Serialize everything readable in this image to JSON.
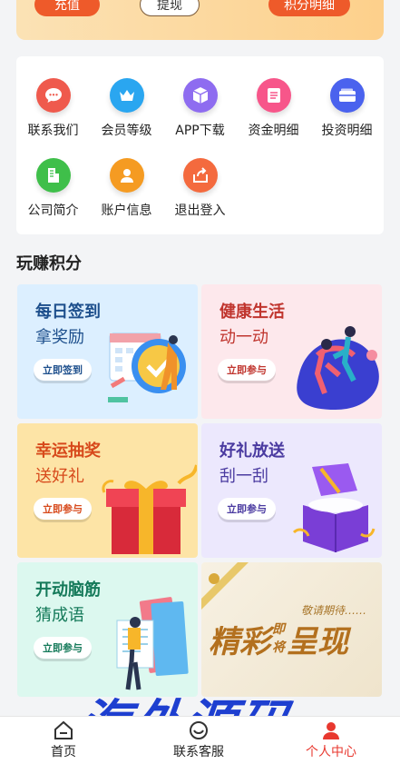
{
  "top_banner": {
    "recharge": "充值",
    "withdraw": "提现",
    "points_detail": "积分明细"
  },
  "grid": {
    "items": [
      {
        "label": "联系我们",
        "icon": "chat-icon",
        "color": "#ef5a4d"
      },
      {
        "label": "会员等级",
        "icon": "crown-icon",
        "color": "#2aa6f0"
      },
      {
        "label": "APP下载",
        "icon": "cube-icon",
        "color": "#8e6cf0"
      },
      {
        "label": "资金明细",
        "icon": "document-icon",
        "color": "#f7568a"
      },
      {
        "label": "投资明细",
        "icon": "wallet-icon",
        "color": "#4a62ee"
      },
      {
        "label": "公司简介",
        "icon": "building-icon",
        "color": "#3fbf4a"
      },
      {
        "label": "账户信息",
        "icon": "user-icon",
        "color": "#f59b22"
      },
      {
        "label": "退出登入",
        "icon": "logout-icon",
        "color": "#f46a3e"
      }
    ]
  },
  "section": {
    "title": "玩赚积分"
  },
  "cards": {
    "signin": {
      "title": "每日签到",
      "subtitle": "拿奖励",
      "button": "立即签到",
      "title_color": "#1d4f8c",
      "bg": "#dcefff"
    },
    "health": {
      "title": "健康生活",
      "subtitle": "动一动",
      "button": "立即参与",
      "title_color": "#c0352e",
      "bg": "#fde8ec"
    },
    "lottery": {
      "title": "幸运抽奖",
      "subtitle": "送好礼",
      "button": "立即参与",
      "title_color": "#d7491b",
      "bg": "#fde4a6"
    },
    "gift": {
      "title": "好礼放送",
      "subtitle": "刮一刮",
      "button": "立即参与",
      "title_color": "#4a3aa0",
      "bg": "#ece8fd"
    },
    "brain": {
      "title": "开动脑筋",
      "subtitle": "猜成语",
      "button": "立即参与",
      "title_color": "#157a5a",
      "bg": "#dcf8ef"
    },
    "coming": {
      "small": "敬请期待……",
      "main": "精彩即将呈现",
      "big1": "精彩",
      "small1": "即",
      "small2": "将",
      "big2": "呈现"
    }
  },
  "bottom_nav": {
    "home": "首页",
    "service": "联系客服",
    "profile": "个人中心",
    "active_color": "#e8382f"
  },
  "watermark": "海外源码"
}
